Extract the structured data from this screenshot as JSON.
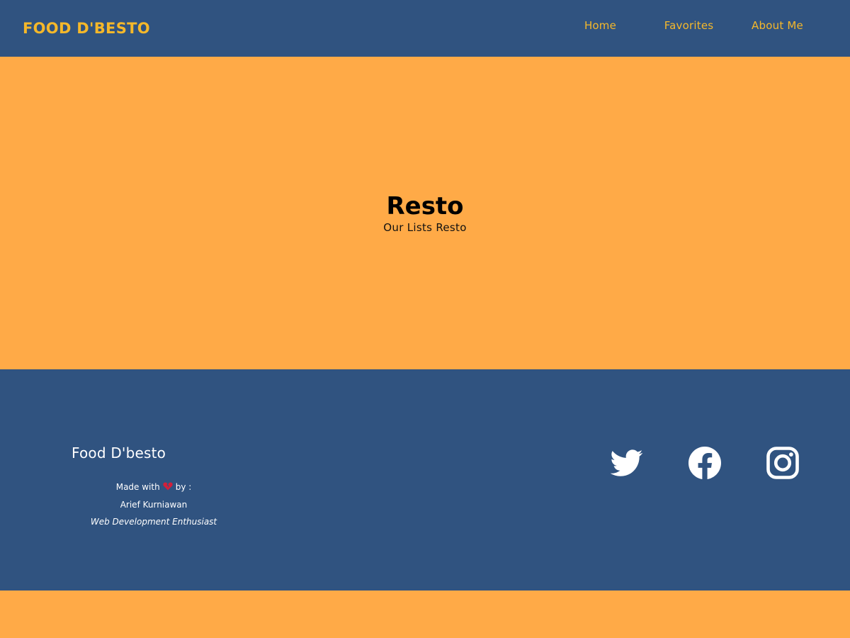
{
  "header": {
    "brand": "FOOD D'BESTO",
    "nav": [
      {
        "label": "Home"
      },
      {
        "label": "Favorites"
      },
      {
        "label": "About Me"
      }
    ]
  },
  "hero": {
    "title": "Resto",
    "subtitle": "Our Lists Resto"
  },
  "footer": {
    "title": "Food D'besto",
    "made_with": "Made with",
    "by": "by :",
    "author": "Arief Kurniawan",
    "role": "Web Development Enthusiast",
    "heart_icon": "broken-heart-icon",
    "social": [
      {
        "icon": "twitter-icon"
      },
      {
        "icon": "facebook-icon"
      },
      {
        "icon": "instagram-icon"
      }
    ]
  },
  "colors": {
    "navy": "#305380",
    "orange": "#ffaa47",
    "accent_yellow": "#f5b82a",
    "white": "#ffffff"
  }
}
